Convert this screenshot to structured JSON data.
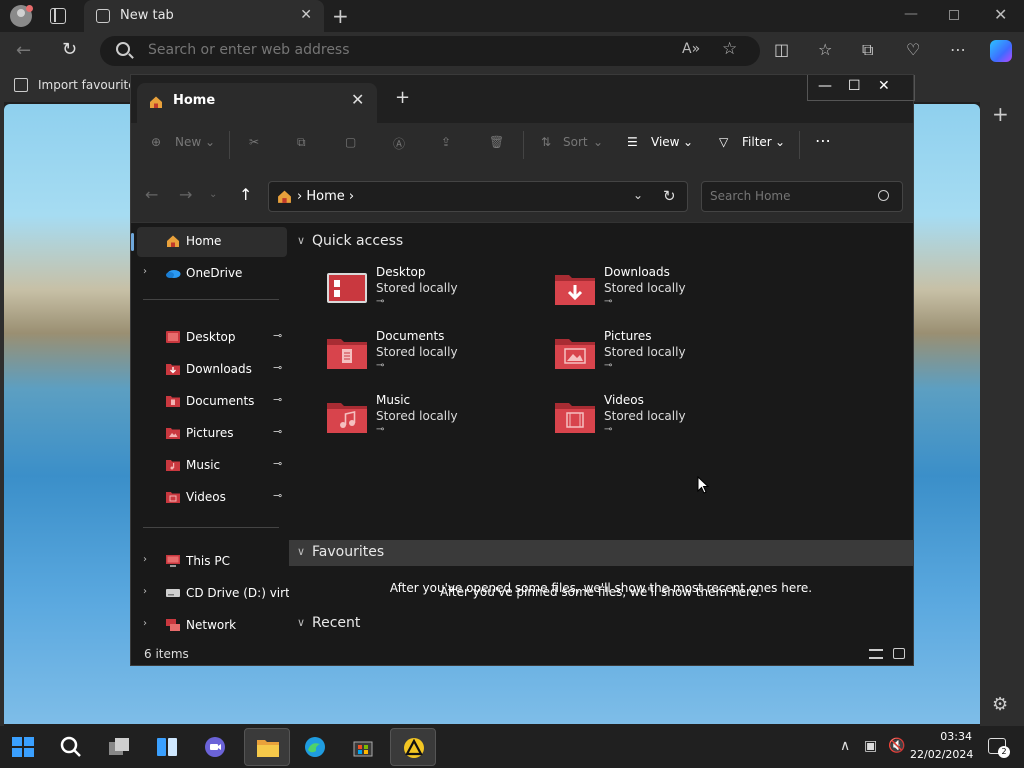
{
  "browser": {
    "tab_title": "New tab",
    "address_placeholder": "Search or enter web address",
    "favbar_import": "Import favourites"
  },
  "explorer": {
    "tab_title": "Home",
    "commands": {
      "new": "New",
      "sort": "Sort",
      "view": "View",
      "filter": "Filter"
    },
    "breadcrumb": "Home",
    "search_placeholder": "Search Home",
    "sidebar": {
      "home": "Home",
      "onedrive": "OneDrive",
      "pinned": [
        "Desktop",
        "Downloads",
        "Documents",
        "Pictures",
        "Music",
        "Videos"
      ],
      "this_pc": "This PC",
      "cd_drive": "CD Drive (D:) virtio-",
      "network": "Network"
    },
    "sections": {
      "quick_access": "Quick access",
      "favourites": "Favourites",
      "recent": "Recent"
    },
    "quick_access_items": [
      {
        "name": "Desktop",
        "sub": "Stored locally"
      },
      {
        "name": "Downloads",
        "sub": "Stored locally"
      },
      {
        "name": "Documents",
        "sub": "Stored locally"
      },
      {
        "name": "Pictures",
        "sub": "Stored locally"
      },
      {
        "name": "Music",
        "sub": "Stored locally"
      },
      {
        "name": "Videos",
        "sub": "Stored locally"
      }
    ],
    "favourites_empty": "After you've pinned some files, we'll show them here.",
    "recent_empty": "After you've opened some files, we'll show the most recent ones here.",
    "status_count": "6 items"
  },
  "taskbar": {
    "time": "03:34",
    "date": "22/02/2024",
    "notifications": "2"
  },
  "colors": {
    "folder_red": "#c9383f",
    "accent": "#6fa8dc"
  }
}
